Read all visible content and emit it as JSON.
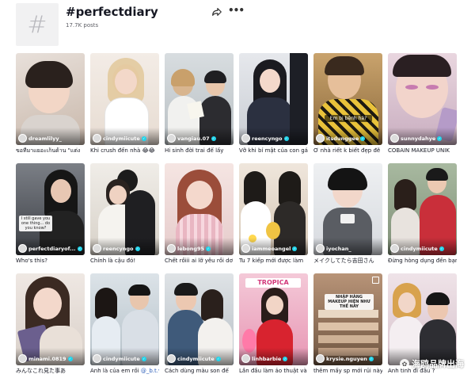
{
  "header": {
    "hash_symbol": "#",
    "title": "#perfectdiary",
    "posts": "17.7K posts"
  },
  "videos": [
    {
      "author": "dreamlilyy_",
      "verified": false,
      "caption": "ขอทีมาแยอะเก็นด้าน \"แต่ง",
      "emoji": ""
    },
    {
      "author": "cindymiicute",
      "verified": true,
      "caption": "Khi crush đến nhà",
      "emoji": "😂😂"
    },
    {
      "author": "vangiau.07",
      "verified": true,
      "caption": "Hi sinh đời trai để lấy",
      "emoji": ""
    },
    {
      "author": "reencyngo",
      "verified": true,
      "caption": "Vỡ khi bí mật của con gái",
      "emoji": ""
    },
    {
      "author": "itsdunggee",
      "verified": true,
      "caption": "Ở nhà riết k biết đẹp đẽ",
      "emoji": "",
      "overlay_text": "Em bị bệnh hả?"
    },
    {
      "author": "sunnydahye",
      "verified": true,
      "caption": "COBAIN MAKEUP UNIK",
      "emoji": ""
    },
    {
      "author": "perfectdiaryof...",
      "verified": true,
      "caption": "Who's this?",
      "emoji": "",
      "overlay_text": "I still gave you one thing... do you know?"
    },
    {
      "author": "reencyngo",
      "verified": true,
      "caption": "Chính là cậu đó!",
      "emoji": ""
    },
    {
      "author": "lebong95",
      "verified": true,
      "caption": "Chết rồiii ai lỡ yêu rồi dơ",
      "emoji": ""
    },
    {
      "author": "iammeoangel",
      "verified": true,
      "caption": "Tu 7 kiếp mới được làm",
      "emoji": ""
    },
    {
      "author": "iyochan_",
      "verified": false,
      "caption": "メイクしてたら吉田さん",
      "emoji": ""
    },
    {
      "author": "cindymiicute",
      "verified": true,
      "caption": "Đừng hòng dụng đến bạn",
      "emoji": ""
    },
    {
      "author": "minami.0819",
      "verified": true,
      "caption": "みんなこれ見た事あ",
      "emoji": ""
    },
    {
      "author": "cindymiicute",
      "verified": true,
      "caption": "Anh là của em rồi",
      "emoji": "",
      "caption_link": "@_b.t.v"
    },
    {
      "author": "cindymiicute",
      "verified": true,
      "caption": "Cách dùng màu son để",
      "emoji": ""
    },
    {
      "author": "linhbarbie",
      "verified": true,
      "caption": "Lần đầu làm ảo thuật và",
      "emoji": "",
      "overlay_text": "TROPICA"
    },
    {
      "author": "krysie.nguyen",
      "verified": true,
      "caption": "thêm mấy sp mới rủi này",
      "emoji": "",
      "overlay_text": "NHẬP HÀNG MAKEUP HIỆN NHƯ THẾ NÀY"
    },
    {
      "author": "",
      "verified": false,
      "caption": "Anh tính đi đâu ?",
      "emoji": ""
    }
  ],
  "watermark": "海鸥品牌出海",
  "icons": {
    "share": "share-arrow-icon",
    "more": "more-horizontal-icon",
    "verified": "verified-badge-icon",
    "avatar": "avatar-icon",
    "hashtag": "hashtag-icon",
    "watermark": "wechat-logo-icon"
  }
}
